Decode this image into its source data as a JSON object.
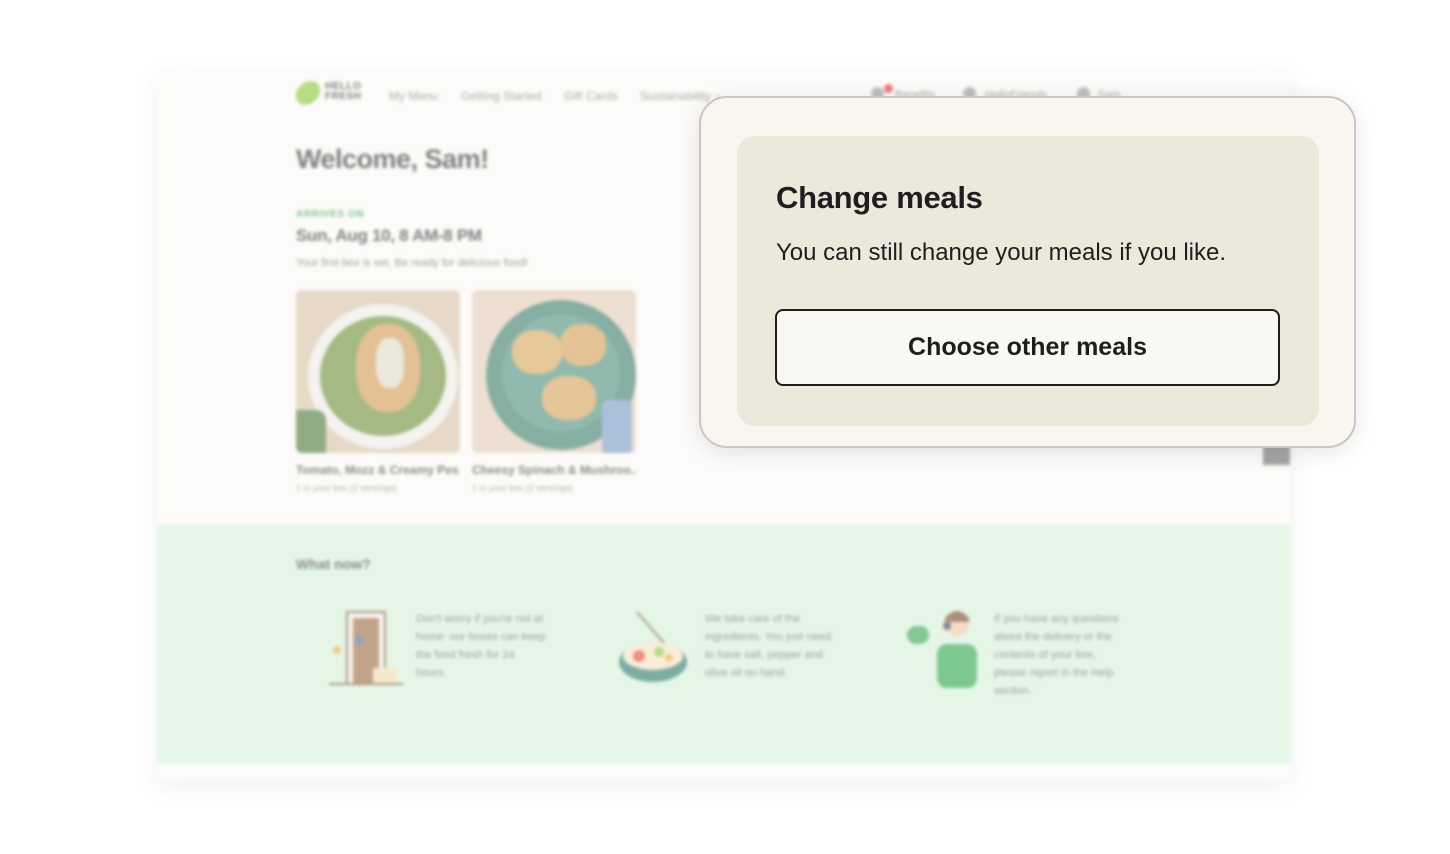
{
  "colors": {
    "brand_green": "#8fc63f",
    "arrives_green": "#3a9c4e",
    "section_mint": "#d6f2d9",
    "popup_bg": "#f8f6ef",
    "popup_card": "#ede8dc",
    "text_dark": "#1e1e1e",
    "notification_red": "#e52b2b"
  },
  "background": {
    "logo": "HELLO FRESH",
    "nav": {
      "links": [
        "My Menu",
        "Getting Started",
        "Gift Cards",
        "Sustainability"
      ],
      "right": [
        "Benefits",
        "HelloFriends",
        "Sam"
      ]
    },
    "welcome": "Welcome, Sam!",
    "arrives": {
      "label": "ARRIVES ON",
      "date": "Sun, Aug 10, 8 AM-8 PM",
      "subtitle": "Your first box is set. Be ready for delicious food!"
    },
    "meals": [
      {
        "title": "Tomato, Mozz & Creamy Pes...",
        "subtitle": "1 in your box (2 servings)"
      },
      {
        "title": "Cheesy Spinach & Mushroo...",
        "subtitle": "1 in your box (2 servings)"
      }
    ],
    "what_now": {
      "title": "What now?",
      "items": [
        {
          "icon": "door-delivery-illustration",
          "text": "Don't worry if you're not at home: our boxes can keep the food fresh for 24 hours."
        },
        {
          "icon": "salad-bowl-illustration",
          "text": "We take care of the ingredients. You just need to have salt, pepper and olive oil on hand."
        },
        {
          "icon": "support-agent-illustration",
          "text": "If you have any questions about the delivery or the contents of your box, please report in the Help section."
        }
      ]
    }
  },
  "popup": {
    "title": "Change meals",
    "description": "You can still change your meals if you like.",
    "button_label": "Choose other meals"
  }
}
